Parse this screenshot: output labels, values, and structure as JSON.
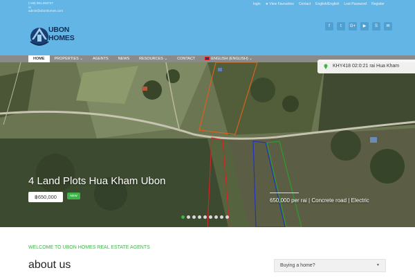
{
  "header": {
    "contact_lines": [
      "(+66) 081-253737",
      "or",
      "admin@ubonhomes.com"
    ],
    "top_links": [
      "login",
      "View Favourites",
      "Contact",
      "English/English",
      "Lost Password",
      "Register"
    ],
    "logo_line1": "UBON",
    "logo_line2": "HOMES",
    "social_icons": [
      "facebook-icon",
      "twitter-icon",
      "google-plus-icon",
      "youtube-icon",
      "skype-icon",
      "email-icon"
    ],
    "social_glyphs": [
      "f",
      "t",
      "G+",
      "▶",
      "S",
      "✉"
    ]
  },
  "nav": {
    "items": [
      "HOME",
      "PROPERTIES ⌄",
      "AGENTS",
      "NEWS",
      "RESOURCES ⌄",
      "CONTACT",
      "ENGLISH (ENGLISH) ⌄"
    ]
  },
  "hero": {
    "reference": "KHY418 02:0:21 rai Hua Kham",
    "title": "4 Land Plots Hua Kham Ubon",
    "price": "฿650,000",
    "badge": "NEW",
    "features": "650,000 per rai  |  Concrete road  |  Electric",
    "slide_count": 9,
    "active_slide": 1
  },
  "content": {
    "welcome": "WELCOME TO UBON HOMES REAL ESTATE AGENTS",
    "about_heading": "about us",
    "dropdown_label": "Buying a home?"
  },
  "colors": {
    "header_bg": "#63b5e6",
    "nav_bg": "#8a8a8a",
    "accent_green": "#3fb24a",
    "plot_orange": "#d9621c",
    "plot_red": "#d42424",
    "plot_blue": "#2233bb",
    "plot_green": "#2e9b2e"
  }
}
